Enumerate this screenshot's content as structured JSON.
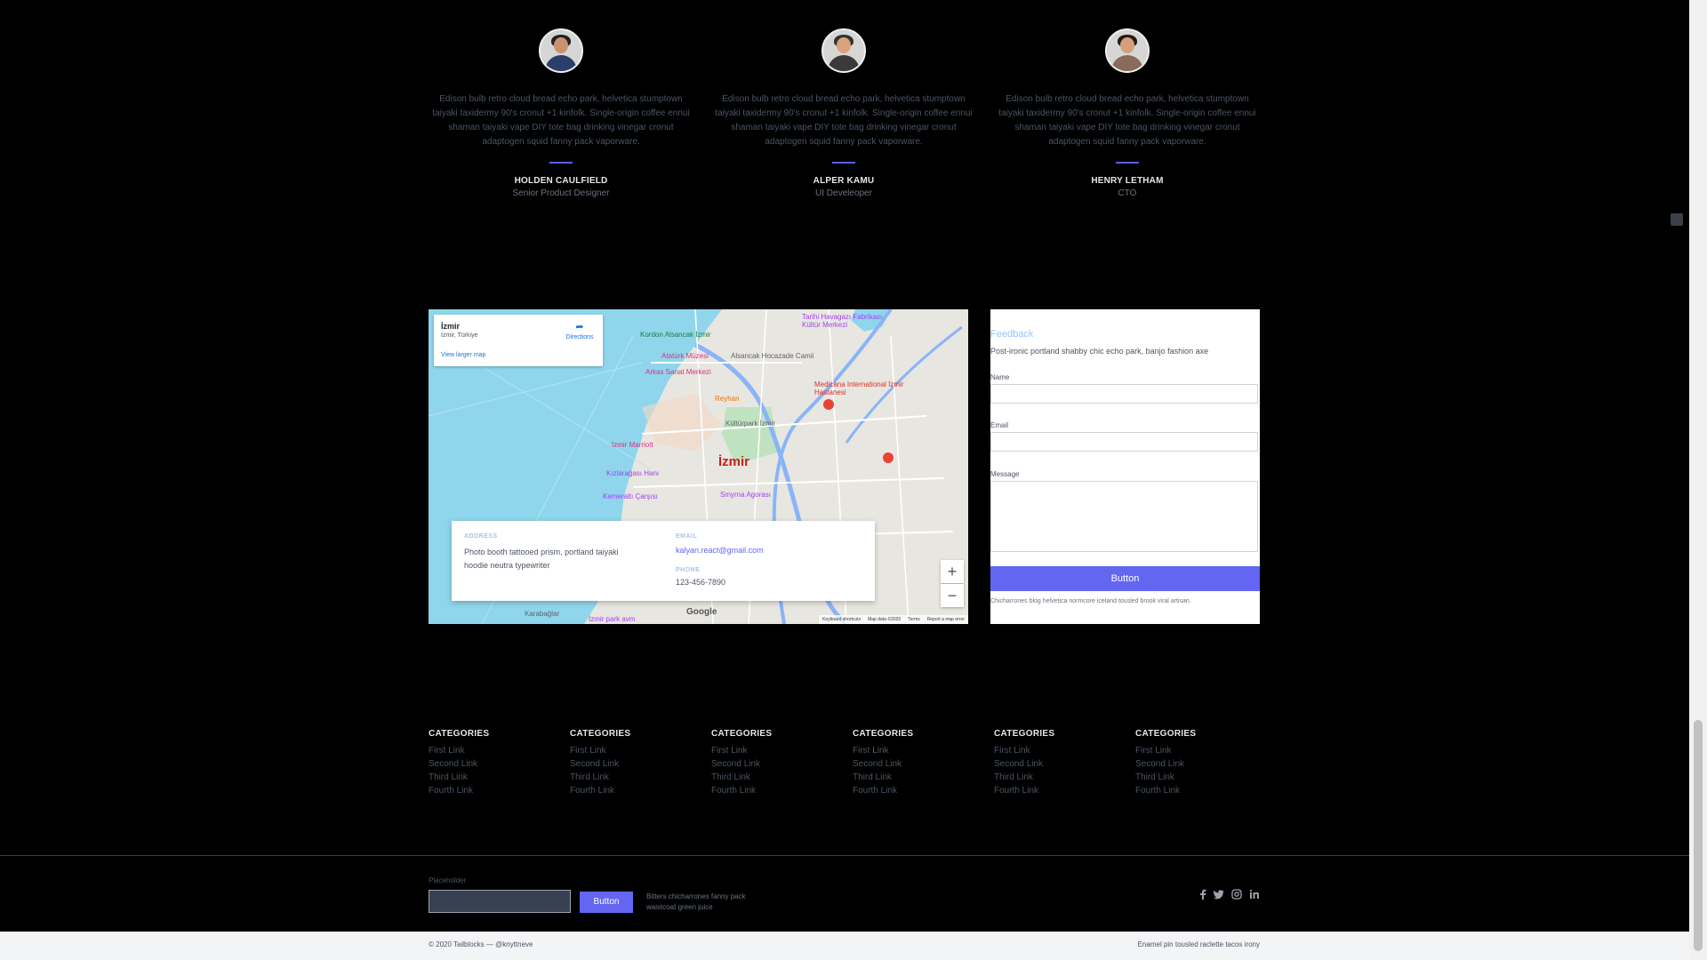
{
  "testimonials": [
    {
      "quote": "Edison bulb retro cloud bread echo park, helvetica stumptown taiyaki taxidermy 90's cronut +1 kinfolk. Single-origin coffee ennui shaman taiyaki vape DIY tote bag drinking vinegar cronut adaptogen squid fanny pack vaporware.",
      "name": "HOLDEN CAULFIELD",
      "role": "Senior Product Designer"
    },
    {
      "quote": "Edison bulb retro cloud bread echo park, helvetica stumptown taiyaki taxidermy 90's cronut +1 kinfolk. Single-origin coffee ennui shaman taiyaki vape DIY tote bag drinking vinegar cronut adaptogen squid fanny pack vaporware.",
      "name": "ALPER KAMU",
      "role": "UI Develeoper"
    },
    {
      "quote": "Edison bulb retro cloud bread echo park, helvetica stumptown taiyaki taxidermy 90's cronut +1 kinfolk. Single-origin coffee ennui shaman taiyaki vape DIY tote bag drinking vinegar cronut adaptogen squid fanny pack vaporware.",
      "name": "HENRY LETHAM",
      "role": "CTO"
    }
  ],
  "map": {
    "card_title": "İzmir",
    "card_subtitle": "İzmir, Türkiye",
    "card_link": "View larger map",
    "directions": "Directions",
    "city": "İzmir",
    "pois": {
      "kordon": "Kordon Alsancak İzmir",
      "ataturk": "Atatürk Müzesi",
      "alsancak": "Alsancak Hocazade Camii",
      "arkas": "Arkas Sanat Merkezi",
      "reyhan": "Reyhan",
      "kultur": "Kültürpark İzmir",
      "tarihi": "Tarihi Havagazı Fabrikası Kültür Merkezi",
      "medicana": "Medicana International İzmir Hastanesi",
      "marriott": "İzmir Marriott",
      "kizlaragasi": "Kızlarağası Hanı",
      "kemeralti": "Kemeraltı Çarşısı",
      "smyrna": "Smyrna Agorası",
      "karabaglar": "Karabağlar",
      "izmirpark": "İzmir park avm"
    },
    "zoom_in": "+",
    "zoom_out": "−",
    "google": "Google",
    "footer": [
      "Keyboard shortcuts",
      "Map data ©2020",
      "Terms",
      "Report a map error"
    ]
  },
  "address": {
    "address_label": "ADDRESS",
    "address_text": "Photo booth tattooed prism, portland taiyaki hoodie neutra typewriter",
    "email_label": "EMAIL",
    "email": "kalyan.react@gmail.com",
    "phone_label": "PHONE",
    "phone": "123-456-7890"
  },
  "form": {
    "title": "Feedback",
    "subtitle": "Post-ironic portland shabby chic echo park, banjo fashion axe",
    "name_label": "Name",
    "email_label": "Email",
    "message_label": "Message",
    "button": "Button",
    "note": "Chicharrones blog helvetica normcore iceland tousled brook viral artisan."
  },
  "footer": {
    "categories": [
      {
        "title": "CATEGORIES",
        "links": [
          "First Link",
          "Second Link",
          "Third Link",
          "Fourth Link"
        ]
      },
      {
        "title": "CATEGORIES",
        "links": [
          "First Link",
          "Second Link",
          "Third Link",
          "Fourth Link"
        ]
      },
      {
        "title": "CATEGORIES",
        "links": [
          "First Link",
          "Second Link",
          "Third Link",
          "Fourth Link"
        ]
      },
      {
        "title": "CATEGORIES",
        "links": [
          "First Link",
          "Second Link",
          "Third Link",
          "Fourth Link"
        ]
      },
      {
        "title": "CATEGORIES",
        "links": [
          "First Link",
          "Second Link",
          "Third Link",
          "Fourth Link"
        ]
      },
      {
        "title": "CATEGORIES",
        "links": [
          "First Link",
          "Second Link",
          "Third Link",
          "Fourth Link"
        ]
      }
    ],
    "subscribe_label": "Placeholder",
    "subscribe_button": "Button",
    "subscribe_note": "Bitters chicharrones fanny pack waistcoat green juice",
    "social_icons": [
      "facebook-icon",
      "twitter-icon",
      "instagram-icon",
      "linkedin-icon"
    ],
    "copyright": "© 2020 Tailblocks — @knyttneve",
    "bottom_right": "Enamel pin tousled raclette tacos irony"
  },
  "colors": {
    "accent": "#6366f1",
    "background": "#000000",
    "water": "#8fd6ec"
  }
}
